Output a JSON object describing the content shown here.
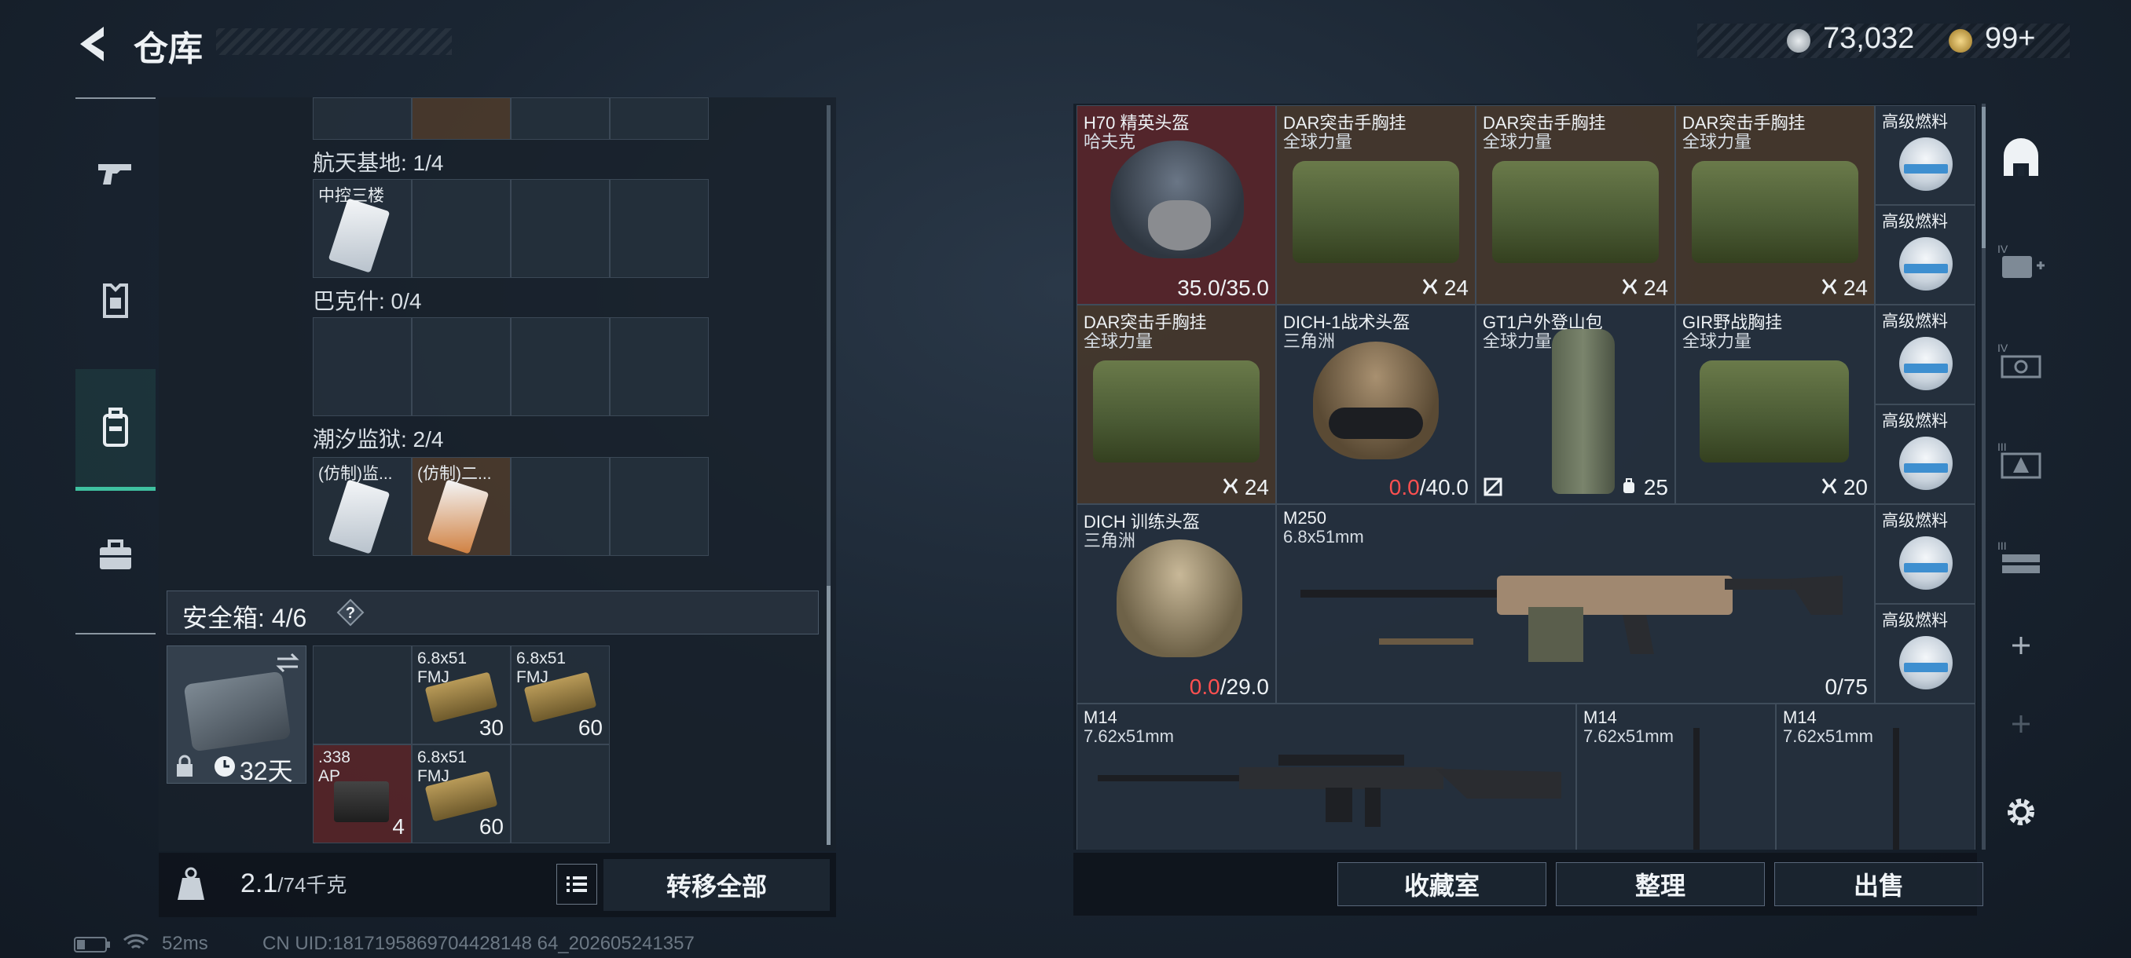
{
  "header": {
    "title": "仓库",
    "currency_silver": "73,032",
    "currency_gold": "99+"
  },
  "left_nav": [
    "gun-icon",
    "armor-icon",
    "backpack-icon",
    "toolbox-icon"
  ],
  "stash": {
    "sections": [
      {
        "label": "航天基地: 1/4",
        "items": [
          {
            "name": "中控三楼"
          }
        ]
      },
      {
        "label": "巴克什: 0/4",
        "items": []
      },
      {
        "label": "潮汐监狱: 2/4",
        "items": [
          {
            "name": "(仿制)监..."
          },
          {
            "name": "(仿制)二..."
          }
        ]
      }
    ]
  },
  "safe_box": {
    "label": "安全箱:  4/6",
    "help": "?",
    "duration": "32天",
    "items": [
      {
        "name": "6.8x51 FMJ",
        "count": "30"
      },
      {
        "name": "6.8x51 FMJ",
        "count": "60"
      },
      {
        "name": ".338 AP",
        "count": "4"
      },
      {
        "name": "6.8x51 FMJ",
        "count": "60"
      }
    ]
  },
  "weight": {
    "current": "2.1",
    "max": "/74千克"
  },
  "transfer_all": "转移全部",
  "inventory": [
    {
      "name": "H70 精英头盔",
      "sub": "哈夫克",
      "value": "35.0/35.0"
    },
    {
      "name": "DAR突击手胸挂",
      "sub": "全球力量",
      "value": "24"
    },
    {
      "name": "DAR突击手胸挂",
      "sub": "全球力量",
      "value": "24"
    },
    {
      "name": "DAR突击手胸挂",
      "sub": "全球力量",
      "value": "24"
    },
    {
      "name": "DAR突击手胸挂",
      "sub": "全球力量",
      "value": "24"
    },
    {
      "name": "DICH-1战术头盔",
      "sub": "三角洲",
      "value_red": "0.0",
      "value": "/40.0"
    },
    {
      "name": "GT1户外登山包",
      "sub": "全球力量",
      "value": "25"
    },
    {
      "name": "GIR野战胸挂",
      "sub": "全球力量",
      "value": "20"
    },
    {
      "name": "DICH 训练头盔",
      "sub": "三角洲",
      "value_red": "0.0",
      "value": "/29.0"
    },
    {
      "name": "M250",
      "sub": "6.8x51mm",
      "value": "0/75"
    },
    {
      "name": "M14",
      "sub": "7.62x51mm"
    },
    {
      "name": "M14",
      "sub": "7.62x51mm"
    },
    {
      "name": "M14",
      "sub": "7.62x51mm"
    }
  ],
  "fuel_items": [
    "高级燃料",
    "高级燃料",
    "高级燃料",
    "高级燃料",
    "高级燃料",
    "高级燃料"
  ],
  "right_nav": [
    "home-base-icon",
    "medkit-icon",
    "ammo-box-icon",
    "armor-plate-icon",
    "weapon-rack-icon",
    "add-icon",
    "add-icon",
    "settings-icon"
  ],
  "actions": {
    "collection": "收藏室",
    "sort": "整理",
    "sell": "出售"
  },
  "status": {
    "ping": "52ms",
    "uid": "CN UID:1817195869704428148 64_202605241357"
  },
  "colors": {
    "accent": "#3fc1a0",
    "red_value": "#ff5050"
  }
}
